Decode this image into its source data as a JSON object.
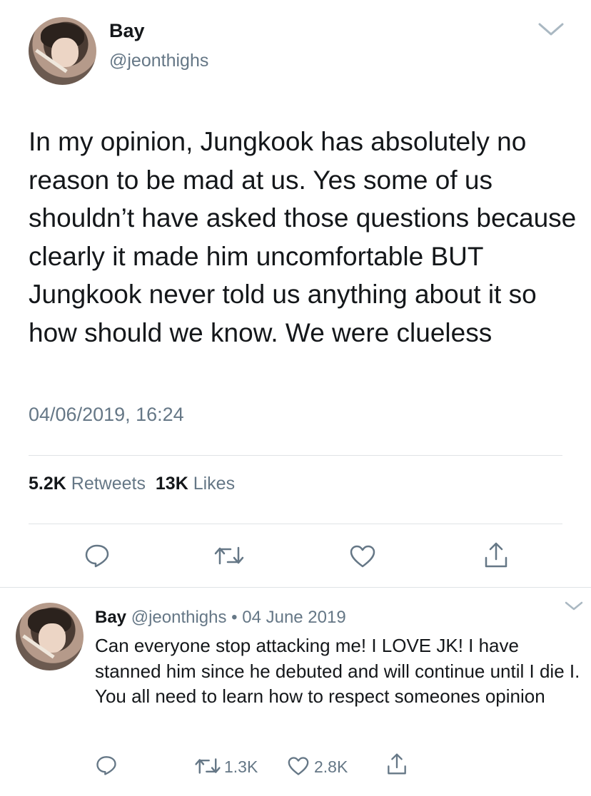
{
  "tweet": {
    "name": "Bay",
    "handle": "@jeonthighs",
    "text": "In my opinion, Jungkook has absolutely no reason to be mad at us. Yes some of us shouldn’t have asked those questions because clearly it made him uncomfortable BUT Jungkook never told us anything about it so how should we know. We were clueless",
    "timestamp": "04/06/2019, 16:24",
    "retweets_count": "5.2K",
    "retweets_label": "Retweets",
    "likes_count": "13K",
    "likes_label": "Likes",
    "icons": [
      "chevron-down-icon",
      "reply-icon",
      "retweet-icon",
      "like-icon",
      "share-icon"
    ]
  },
  "reply": {
    "name": "Bay",
    "handle": "@jeonthighs",
    "separator": "•",
    "date": "04 June 2019",
    "text": "Can everyone stop attacking me! I LOVE JK! I have stanned him since he debuted and will continue until I die I. You all need to learn how to respect someones opinion",
    "retweets": "1.3K",
    "likes": "2.8K"
  },
  "colors": {
    "text": "#14171a",
    "muted": "#657786",
    "divider": "#dfe3e6",
    "icon": "#657786"
  }
}
